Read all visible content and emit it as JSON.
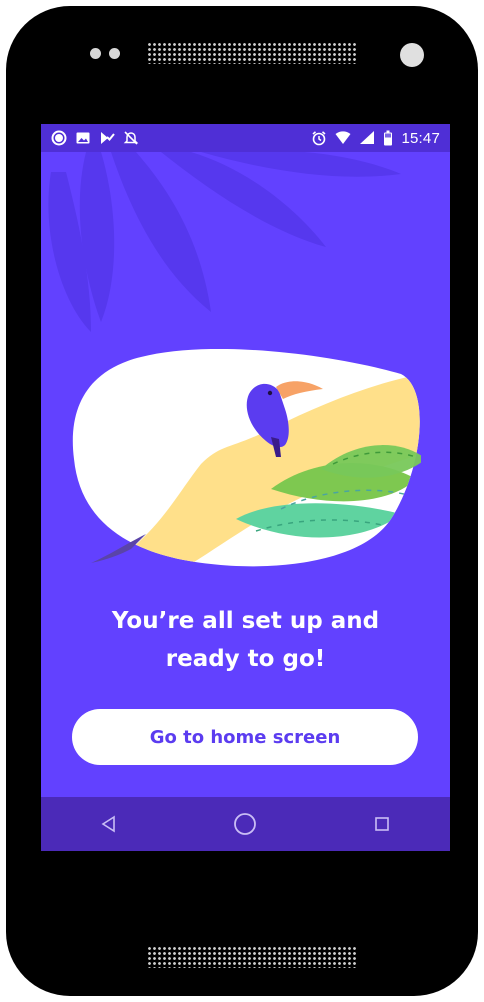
{
  "status_bar": {
    "time": "15:47",
    "left_icons": [
      "signal-messenger-icon",
      "image-icon",
      "tasks-icon",
      "notifications-off-icon"
    ],
    "right_icons": [
      "alarm-icon",
      "wifi-icon",
      "cell-signal-icon",
      "battery-icon"
    ]
  },
  "main": {
    "headline_line1": "You’re all set up and",
    "headline_line2": "ready to go!",
    "cta_label": "Go to home screen"
  },
  "navigation": {
    "buttons": [
      "back-icon",
      "home-icon",
      "recents-icon"
    ]
  },
  "colors": {
    "background": "#6241ff",
    "status_bar": "#4f2fd6",
    "nav_bar": "#4b2ab8",
    "button_text": "#5b3cf0"
  }
}
